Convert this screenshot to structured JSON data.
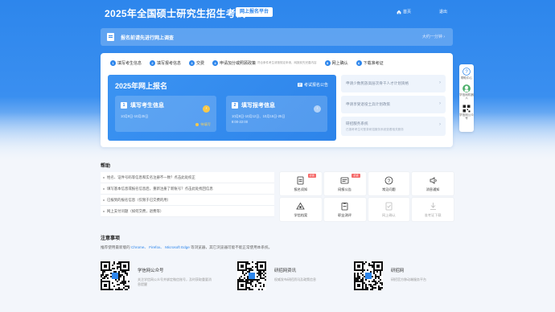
{
  "header": {
    "title": "2025年全国硕士研究生招生考试",
    "tag": "网上报名平台",
    "home": "首页",
    "exit": "退出"
  },
  "survey": {
    "text": "报名前请先进行网上调查",
    "right": "大约一分钟"
  },
  "steps": [
    {
      "num": "1",
      "label": "填写考生信息",
      "sub": ""
    },
    {
      "num": "2",
      "label": "填写报考信息",
      "sub": ""
    },
    {
      "num": "3",
      "label": "交费",
      "sub": ""
    },
    {
      "num": "4",
      "label": "申请加分或照顾政策",
      "sub": "符合条件考生请按规定申请，网报前先完善内容"
    },
    {
      "num": "5",
      "label": "网上确认",
      "sub": ""
    },
    {
      "num": "6",
      "label": "下载准考证",
      "sub": ""
    }
  ],
  "registration": {
    "title": "2025年网上报名",
    "link": "考试报名公告",
    "box1": {
      "num": "1",
      "title": "填写考生信息",
      "date": "10月8日-10月25日",
      "status": "待填写"
    },
    "box2": {
      "num": "2",
      "title": "填写报考信息",
      "date1": "10月8日-10月12日、10月15日-25日",
      "date2": "8:00-22:00"
    }
  },
  "side_links": [
    {
      "title": "申请少数民族高层次骨干人才计划资格",
      "sub": ""
    },
    {
      "title": "申请享受退役士兵计划政策",
      "sub": ""
    },
    {
      "title": "研招服务系统",
      "sub": "已报考考生可登录研招服务系统查看相关服务"
    }
  ],
  "float_bar": [
    {
      "label": "帮助中心",
      "icon": "help-circle-icon"
    },
    {
      "label": "学信网机器人",
      "icon": "robot-avatar-icon"
    },
    {
      "label": "学信网公众号",
      "icon": "qr-code-icon"
    }
  ],
  "help": {
    "title": "帮助",
    "items": [
      "姓名、证件号码等信息和实名注册不一致？点击此处校正",
      "填写基本信息或报名信息后，重新注册了新账号？点击此处找回信息",
      "已报到的报名信息（仅限于已交费的用）",
      "网上支付问题（如何交费，退费等）"
    ],
    "tiles": [
      {
        "label": "报名须知",
        "icon": "doc-icon",
        "badge": "必读",
        "enabled": true
      },
      {
        "label": "网报公告",
        "icon": "notice-icon",
        "badge": "必读",
        "enabled": true
      },
      {
        "label": "常见问题",
        "icon": "question-icon",
        "badge": "",
        "enabled": true
      },
      {
        "label": "消息通知",
        "icon": "speaker-icon",
        "badge": "",
        "enabled": true
      },
      {
        "label": "学信档案",
        "icon": "archive-icon",
        "badge": "",
        "enabled": true
      },
      {
        "label": "职业测评",
        "icon": "clipboard-icon",
        "badge": "",
        "enabled": true
      },
      {
        "label": "网上确认",
        "icon": "confirm-icon",
        "badge": "",
        "enabled": false
      },
      {
        "label": "准考证下载",
        "icon": "download-icon",
        "badge": "",
        "enabled": false
      }
    ]
  },
  "notice": {
    "title": "注意事项",
    "prefix": "推荐使用最新版的",
    "browsers": [
      "Chrome、",
      "Firefox、",
      "Microsoft Edge"
    ],
    "suffix": "等浏览器，其它浏览器可能不能正常使用本系统。"
  },
  "qr_cards": [
    {
      "title": "学信网公众号",
      "desc": "关注学信网公众号并绑定微信账号，及时获取重要消息提醒"
    },
    {
      "title": "研招网资讯",
      "desc": "权威发布研招资讯及政策信息"
    },
    {
      "title": "研招网",
      "desc": "研招官方移动端服务平台"
    }
  ],
  "colors": {
    "primary": "#2d86ec",
    "warning": "#f7c84a",
    "badge": "#f56a6a"
  }
}
